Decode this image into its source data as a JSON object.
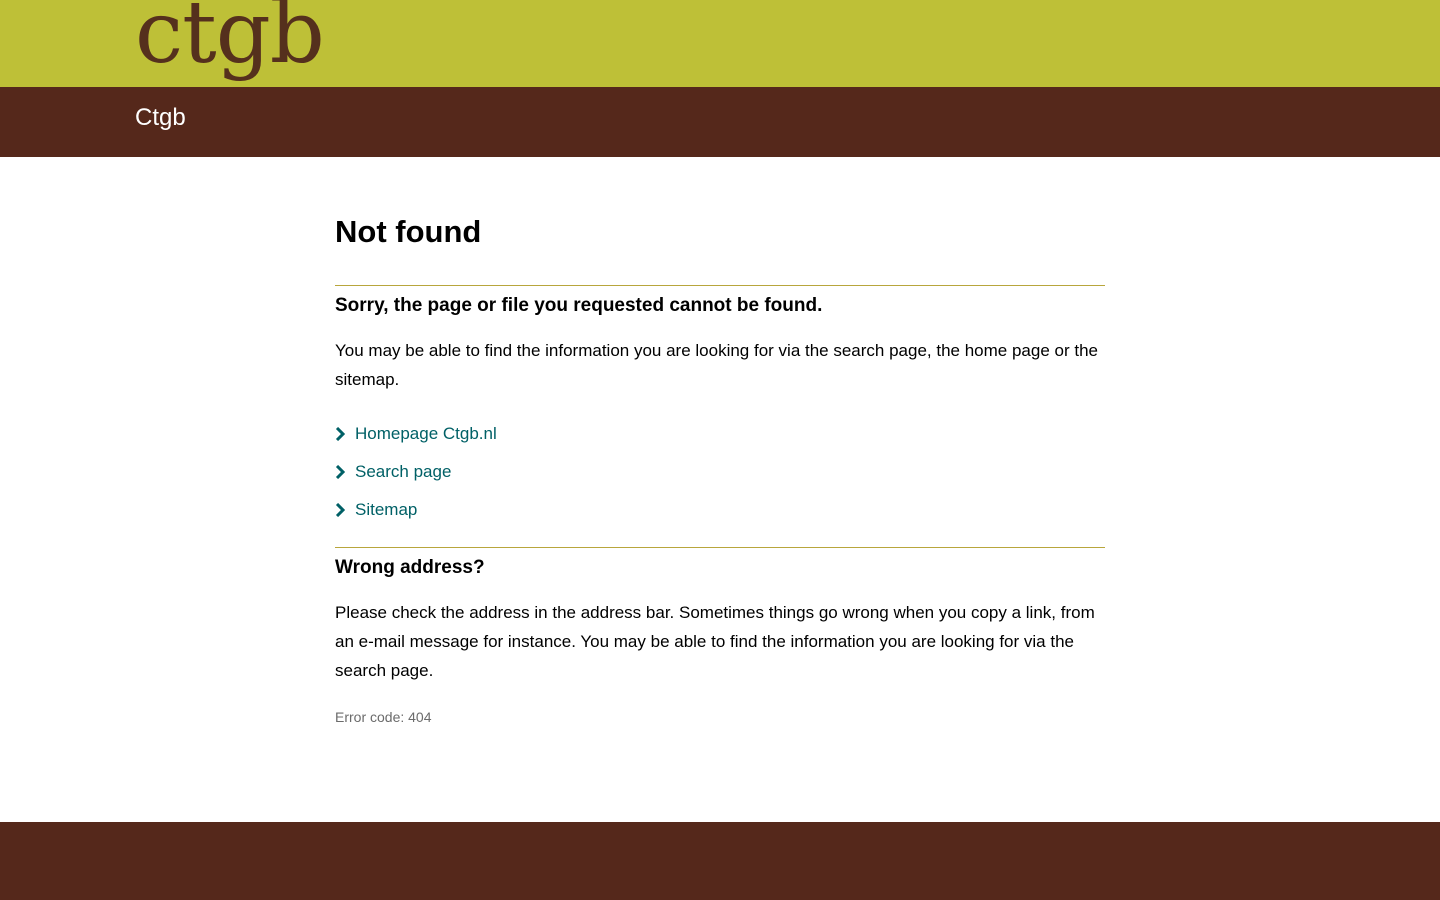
{
  "header": {
    "logo_text": "ctgb",
    "site_name": "Ctgb",
    "colors": {
      "top_bar": "#bec037",
      "title_bar": "#55281b",
      "logo": "#55301d"
    }
  },
  "main": {
    "title": "Not found",
    "sorry_heading": "Sorry, the page or file you requested cannot be found.",
    "intro_text": "You may be able to find the information you are looking for via the search page, the home page or the sitemap.",
    "links": [
      {
        "label": "Homepage Ctgb.nl",
        "icon": "chevron-right-icon"
      },
      {
        "label": "Search page",
        "icon": "chevron-right-icon"
      },
      {
        "label": "Sitemap",
        "icon": "chevron-right-icon"
      }
    ],
    "wrong_address_heading": "Wrong address?",
    "wrong_address_text": "Please check the address in the address bar. Sometimes things go wrong when you copy a link, from an e-mail message for instance. You may be able to find the information you are looking for via the search page.",
    "error_code": "Error code: 404",
    "colors": {
      "link": "#006066",
      "divider": "#b8a63c"
    }
  },
  "footer": {
    "colors": {
      "background": "#55281b"
    }
  }
}
